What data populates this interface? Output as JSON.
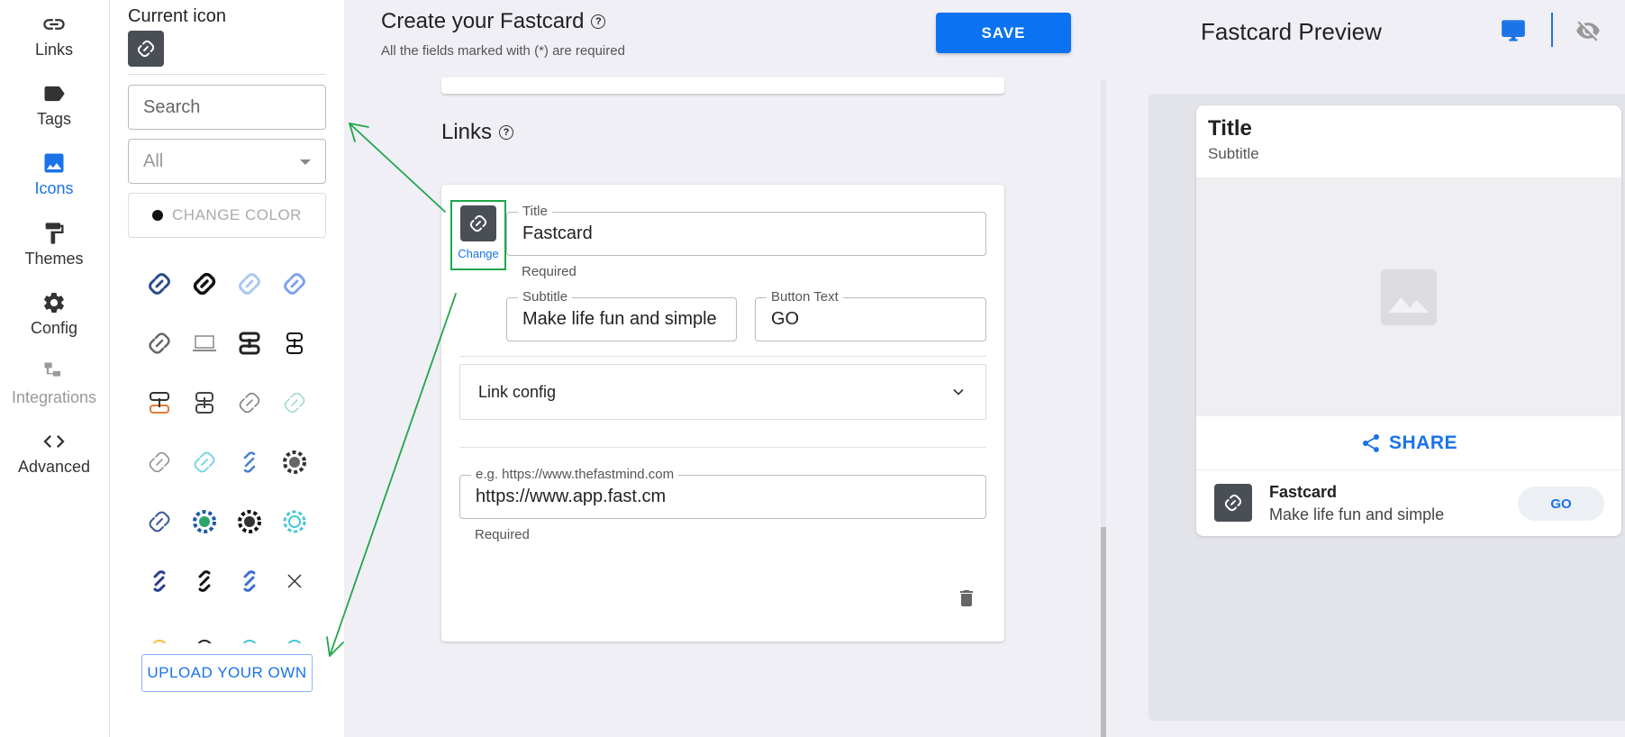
{
  "nav": {
    "items": [
      {
        "label": "Links",
        "icon": "link-icon",
        "state": "normal"
      },
      {
        "label": "Tags",
        "icon": "tag-icon",
        "state": "normal"
      },
      {
        "label": "Icons",
        "icon": "image-icon",
        "state": "active"
      },
      {
        "label": "Themes",
        "icon": "paint-roller-icon",
        "state": "normal"
      },
      {
        "label": "Config",
        "icon": "gear-icon",
        "state": "normal"
      },
      {
        "label": "Integrations",
        "icon": "hierarchy-icon",
        "state": "disabled"
      },
      {
        "label": "Advanced",
        "icon": "code-icon",
        "state": "normal"
      }
    ]
  },
  "picker": {
    "current_icon_label": "Current icon",
    "search_placeholder": "Search",
    "filter_value": "All",
    "change_color_label": "CHANGE COLOR",
    "upload_label": "UPLOAD YOUR OWN"
  },
  "header": {
    "title": "Create your Fastcard",
    "subtitle": "All the fields marked with (*) are required",
    "save_label": "SAVE"
  },
  "links_section": {
    "heading": "Links",
    "change_label": "Change",
    "title_label": "Title",
    "title_value": "Fastcard",
    "title_helper": "Required",
    "subtitle_label": "Subtitle",
    "subtitle_value": "Make life fun and simple",
    "button_text_label": "Button Text",
    "button_text_value": "GO",
    "link_config_label": "Link config",
    "url_label": "e.g. https://www.thefastmind.com",
    "url_value": "https://www.app.fast.cm",
    "url_helper": "Required"
  },
  "preview": {
    "title": "Fastcard Preview",
    "card_title": "Title",
    "card_subtitle": "Subtitle",
    "share_label": "SHARE",
    "link_title": "Fastcard",
    "link_subtitle": "Make life fun and simple",
    "go_label": "GO"
  },
  "colors": {
    "accent": "#0b73f1",
    "annotation": "#1fa64a",
    "icon_tile": "#4a4f55"
  }
}
